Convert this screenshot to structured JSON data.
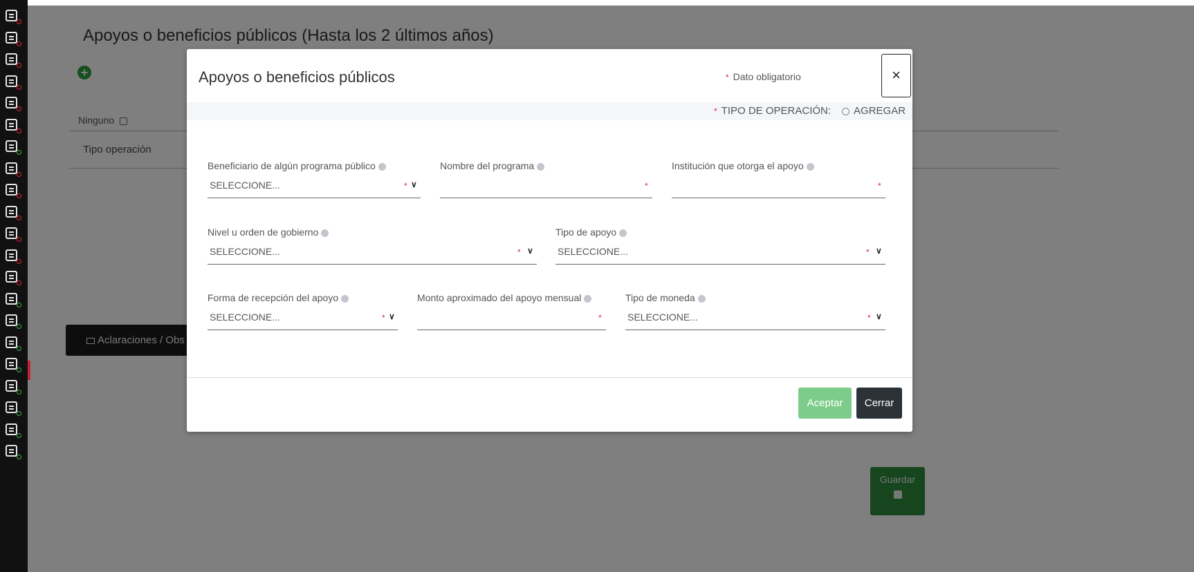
{
  "page": {
    "title": "Apoyos o beneficios públicos (Hasta los 2 últimos años)",
    "ninguno_label": "Ninguno",
    "tipo_operacion_col": "Tipo operación",
    "aclaraciones_label": "Aclaraciones / Obs",
    "guardar_label": "Guardar"
  },
  "rail": {
    "items": [
      {
        "icon": "form-icon",
        "status": "red"
      },
      {
        "icon": "home-icon",
        "status": "red"
      },
      {
        "icon": "document-icon",
        "status": "red"
      },
      {
        "icon": "building-icon",
        "status": "red"
      },
      {
        "icon": "people-icon",
        "status": "red"
      },
      {
        "icon": "family-icon",
        "status": "red"
      },
      {
        "icon": "id-card-icon",
        "status": "green"
      },
      {
        "icon": "search-card-icon",
        "status": "red"
      },
      {
        "icon": "house-icon",
        "status": "red"
      },
      {
        "icon": "car-icon",
        "status": "red"
      },
      {
        "icon": "chart-icon",
        "status": "red"
      },
      {
        "icon": "handshake-icon",
        "status": "red"
      },
      {
        "icon": "money-icon",
        "status": "red"
      },
      {
        "icon": "location-icon",
        "status": "green"
      },
      {
        "icon": "pie-chart-icon",
        "status": "green"
      },
      {
        "icon": "network-icon",
        "status": "green"
      },
      {
        "icon": "group-icon",
        "status": "green"
      },
      {
        "icon": "hierarchy-icon",
        "status": "green"
      },
      {
        "icon": "stats-board-icon",
        "status": "green"
      },
      {
        "icon": "person-icon",
        "status": "green"
      },
      {
        "icon": "checklist-icon",
        "status": "green"
      }
    ]
  },
  "modal": {
    "title": "Apoyos o beneficios públicos",
    "required_note": "Dato obligatorio",
    "close_symbol": "×",
    "operation_label": "TIPO DE OPERACIÓN:",
    "operation_option": "AGREGAR",
    "fields": {
      "beneficiario": {
        "label": "Beneficiario de algún programa público",
        "value": "SELECCIONE..."
      },
      "nombre_programa": {
        "label": "Nombre del programa",
        "value": ""
      },
      "institucion": {
        "label": "Institución que otorga el apoyo",
        "value": ""
      },
      "nivel_gobierno": {
        "label": "Nivel u orden de gobierno",
        "value": "SELECCIONE..."
      },
      "tipo_apoyo": {
        "label": "Tipo de apoyo",
        "value": "SELECCIONE..."
      },
      "forma_recepcion": {
        "label": "Forma de recepción del apoyo",
        "value": "SELECCIONE..."
      },
      "monto": {
        "label": "Monto aproximado del apoyo mensual",
        "value": ""
      },
      "tipo_moneda": {
        "label": "Tipo de moneda",
        "value": "SELECCIONE..."
      }
    },
    "accept_label": "Aceptar",
    "close_label": "Cerrar"
  },
  "colors": {
    "accent_green": "#2e8b3d",
    "required_red": "#e0263a",
    "accept_green": "#7ecc8b",
    "dark_button": "#2b3238"
  }
}
